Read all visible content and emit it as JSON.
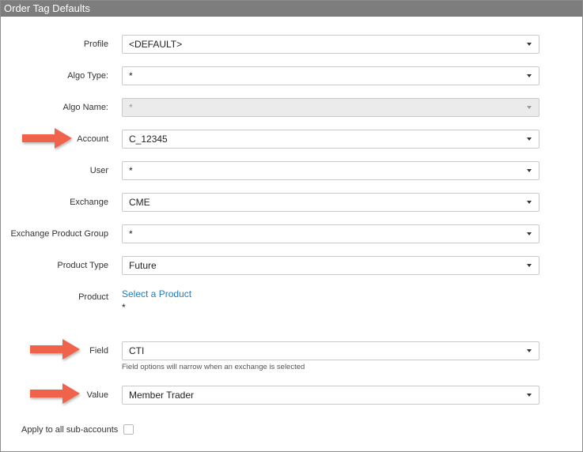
{
  "window": {
    "title": "Order Tag Defaults"
  },
  "form": {
    "profile": {
      "label": "Profile",
      "value": "<DEFAULT>"
    },
    "algo_type": {
      "label": "Algo Type:",
      "value": "*"
    },
    "algo_name": {
      "label": "Algo Name:",
      "value": "*"
    },
    "account": {
      "label": "Account",
      "value": "C_12345"
    },
    "user": {
      "label": "User",
      "value": "*"
    },
    "exchange": {
      "label": "Exchange",
      "value": "CME"
    },
    "exchange_product_group": {
      "label": "Exchange Product Group",
      "value": "*"
    },
    "product_type": {
      "label": "Product Type",
      "value": "Future"
    },
    "product": {
      "label": "Product",
      "link": "Select a Product",
      "value": "*"
    },
    "field": {
      "label": "Field",
      "value": "CTI",
      "hint": "Field options will narrow when an exchange is selected"
    },
    "value": {
      "label": "Value",
      "value": "Member Trader"
    },
    "apply_sub_accounts": {
      "label": "Apply to all sub-accounts",
      "checked": false
    }
  },
  "annotations": {
    "arrow_color": "#f0634b",
    "arrow_icon": "right-arrow-icon"
  }
}
